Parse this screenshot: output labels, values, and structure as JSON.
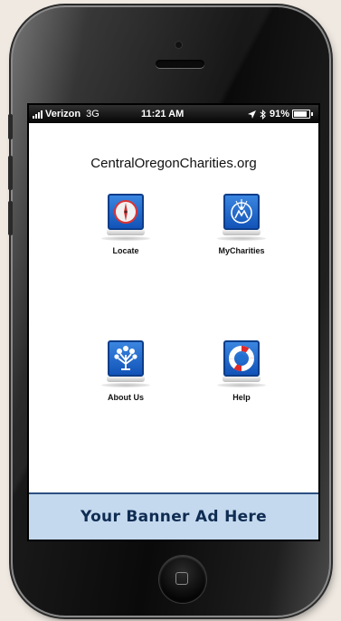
{
  "status_bar": {
    "carrier": "Verizon",
    "network": "3G",
    "time": "11:21 AM",
    "battery": "91%"
  },
  "app": {
    "title": "CentralOregonCharities.org",
    "tiles": [
      {
        "label": "Locate",
        "icon": "compass-icon"
      },
      {
        "label": "MyCharities",
        "icon": "charity-hands-icon"
      },
      {
        "label": "About Us",
        "icon": "tree-icon"
      },
      {
        "label": "Help",
        "icon": "life-preserver-icon"
      }
    ]
  },
  "banner": {
    "text": "Your Banner Ad Here"
  },
  "colors": {
    "icon_blue": "#1f6fd1",
    "banner_bg": "#c4d9ee",
    "banner_text": "#0f2c52"
  }
}
